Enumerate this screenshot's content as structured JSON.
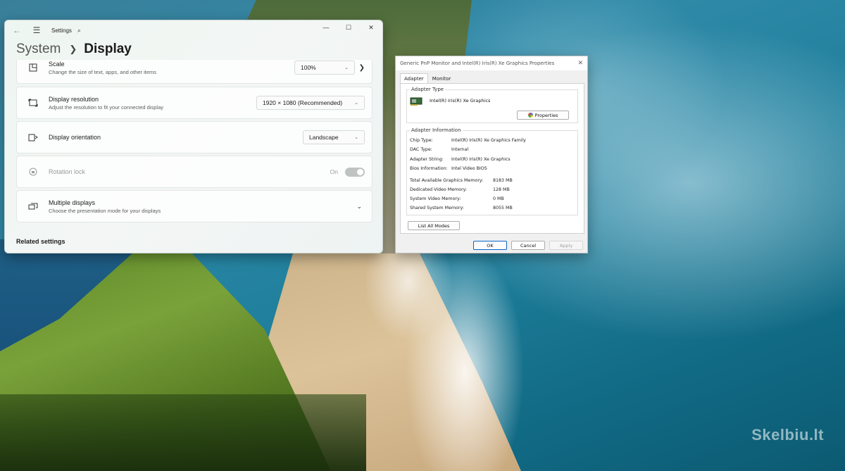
{
  "settings_window": {
    "title": "Settings",
    "breadcrumb": {
      "parent": "System",
      "current": "Display"
    },
    "scale": {
      "title": "Scale",
      "description": "Change the size of text, apps, and other items",
      "value": "100%"
    },
    "resolution": {
      "title": "Display resolution",
      "description": "Adjust the resolution to fit your connected display",
      "value": "1920 × 1080 (Recommended)"
    },
    "orientation": {
      "title": "Display orientation",
      "value": "Landscape"
    },
    "rotation_lock": {
      "title": "Rotation lock",
      "state": "On"
    },
    "multiple_displays": {
      "title": "Multiple displays",
      "description": "Choose the presentation mode for your displays"
    },
    "related_settings": "Related settings"
  },
  "properties_dialog": {
    "title": "Generic PnP Monitor and Intel(R) Iris(R) Xe Graphics Properties",
    "tabs": [
      "Adapter",
      "Monitor"
    ],
    "adapter_type": {
      "label": "Adapter Type",
      "name": "Intel(R) Iris(R) Xe Graphics",
      "properties_button": "Properties"
    },
    "adapter_info": {
      "label": "Adapter Information",
      "chip_type": {
        "label": "Chip Type:",
        "value": "Intel(R) Iris(R) Xe Graphics Family"
      },
      "dac_type": {
        "label": "DAC Type:",
        "value": "Internal"
      },
      "adapter_string": {
        "label": "Adapter String:",
        "value": "Intel(R) Iris(R) Xe Graphics"
      },
      "bios_info": {
        "label": "Bios Information:",
        "value": "Intel Video BIOS"
      }
    },
    "memory": {
      "total": {
        "label": "Total Available Graphics Memory:",
        "value": "8183 MB"
      },
      "dedicated": {
        "label": "Dedicated Video Memory:",
        "value": "128 MB"
      },
      "system": {
        "label": "System Video Memory:",
        "value": "0 MB"
      },
      "shared": {
        "label": "Shared System Memory:",
        "value": "8055 MB"
      }
    },
    "list_all_modes": "List All Modes",
    "buttons": {
      "ok": "OK",
      "cancel": "Cancel",
      "apply": "Apply"
    }
  },
  "watermark": "Skelbiu.lt"
}
